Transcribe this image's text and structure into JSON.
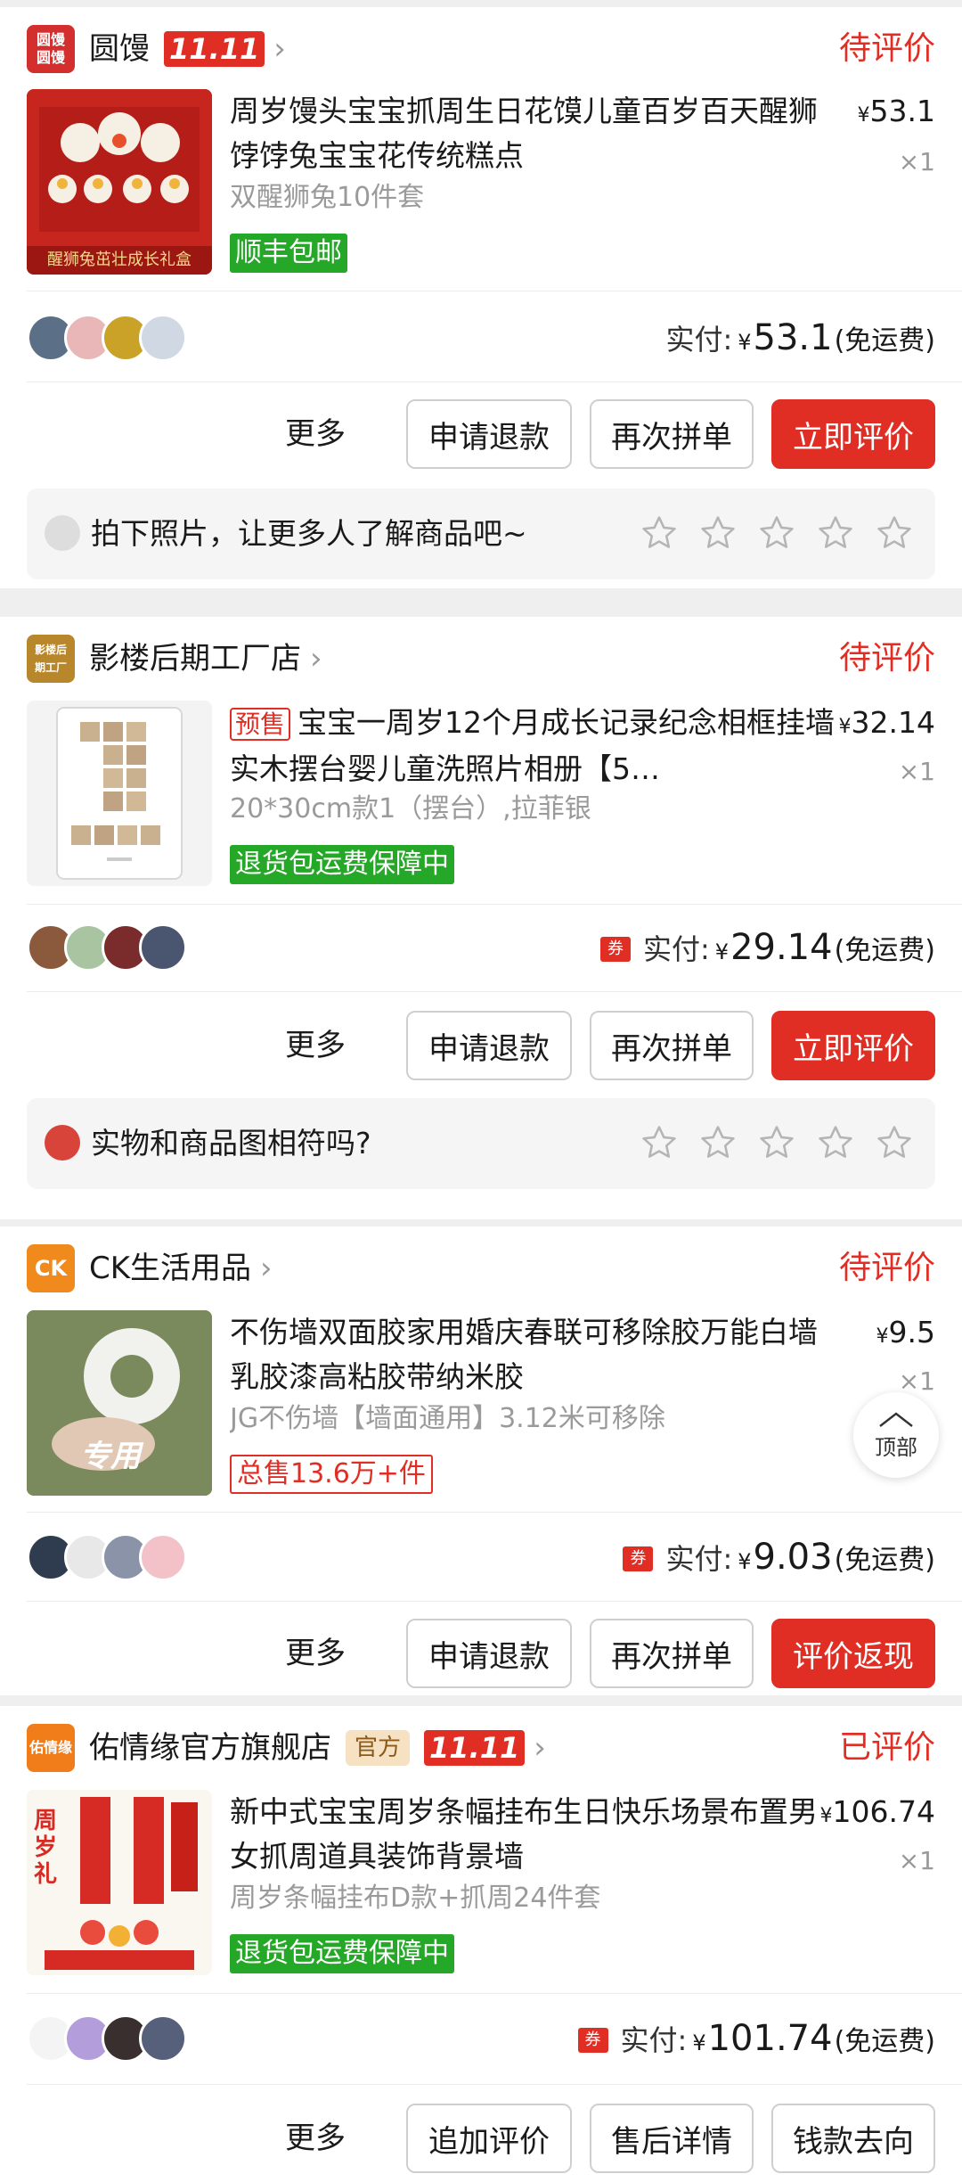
{
  "common": {
    "more_label": "更多",
    "refund_label": "申请退款",
    "rebuy_label": "再次拼单",
    "paid_label": "实付:",
    "yen": "¥",
    "free_shipping": "(免运费)",
    "coupon_icon": "券",
    "qty": "×1",
    "badge_1111": "11.11",
    "back_to_top": "顶部"
  },
  "orders": [
    {
      "shop_logo": "圆馒圆馒",
      "shop_logo_color": "#d32f2f",
      "shop_name": "圆馒",
      "status": "待评价",
      "title": "周岁馒头宝宝抓周生日花馍儿童百岁百天醒狮饽饽兔宝宝花传统糕点",
      "price": "53.1",
      "spec": "双醒狮兔10件套",
      "tag": "顺丰包邮",
      "thumb_caption": "醒狮兔茁壮成长礼盒",
      "paid_amount": "53.1",
      "action_primary": "立即评价",
      "review_prompt": "拍下照片，让更多人了解商品吧~"
    },
    {
      "shop_logo": "影楼后期工厂",
      "shop_logo_color": "#b8862b",
      "shop_name": "影楼后期工厂店",
      "status": "待评价",
      "presale": "预售",
      "title": "宝宝一周岁12个月成长记录纪念相框挂墙实木摆台婴儿童洗照片相册【5…",
      "price": "32.14",
      "spec": "20*30cm款1（摆台）,拉菲银",
      "tag": "退货包运费保障中",
      "paid_amount": "29.14",
      "action_primary": "立即评价",
      "review_prompt": "实物和商品图相符吗?"
    },
    {
      "shop_logo": "CK",
      "shop_logo_color": "#f08a1c",
      "shop_name": "CK生活用品",
      "status": "待评价",
      "title": "不伤墙双面胶家用婚庆春联可移除胶万能白墙乳胶漆高粘胶带纳米胶",
      "price": "9.5",
      "spec": "JG不伤墙【墙面通用】3.12米可移除",
      "tag": "总售13.6万+件",
      "thumb_caption": "专用",
      "paid_amount": "9.03",
      "action_primary": "评价返现"
    },
    {
      "shop_logo": "佑情缘",
      "shop_logo_color": "#f07c1a",
      "shop_name": "佑情缘官方旗舰店",
      "official_badge": "官方",
      "status": "已评价",
      "title": "新中式宝宝周岁条幅挂布生日快乐场景布置男女抓周道具装饰背景墙",
      "price": "106.74",
      "spec": "周岁条幅挂布D款+抓周24件套",
      "tag": "退货包运费保障中",
      "thumb_caption": "周岁礼",
      "paid_amount": "101.74",
      "action_1": "追加评价",
      "action_2": "售后详情",
      "action_3": "钱款去向"
    }
  ]
}
